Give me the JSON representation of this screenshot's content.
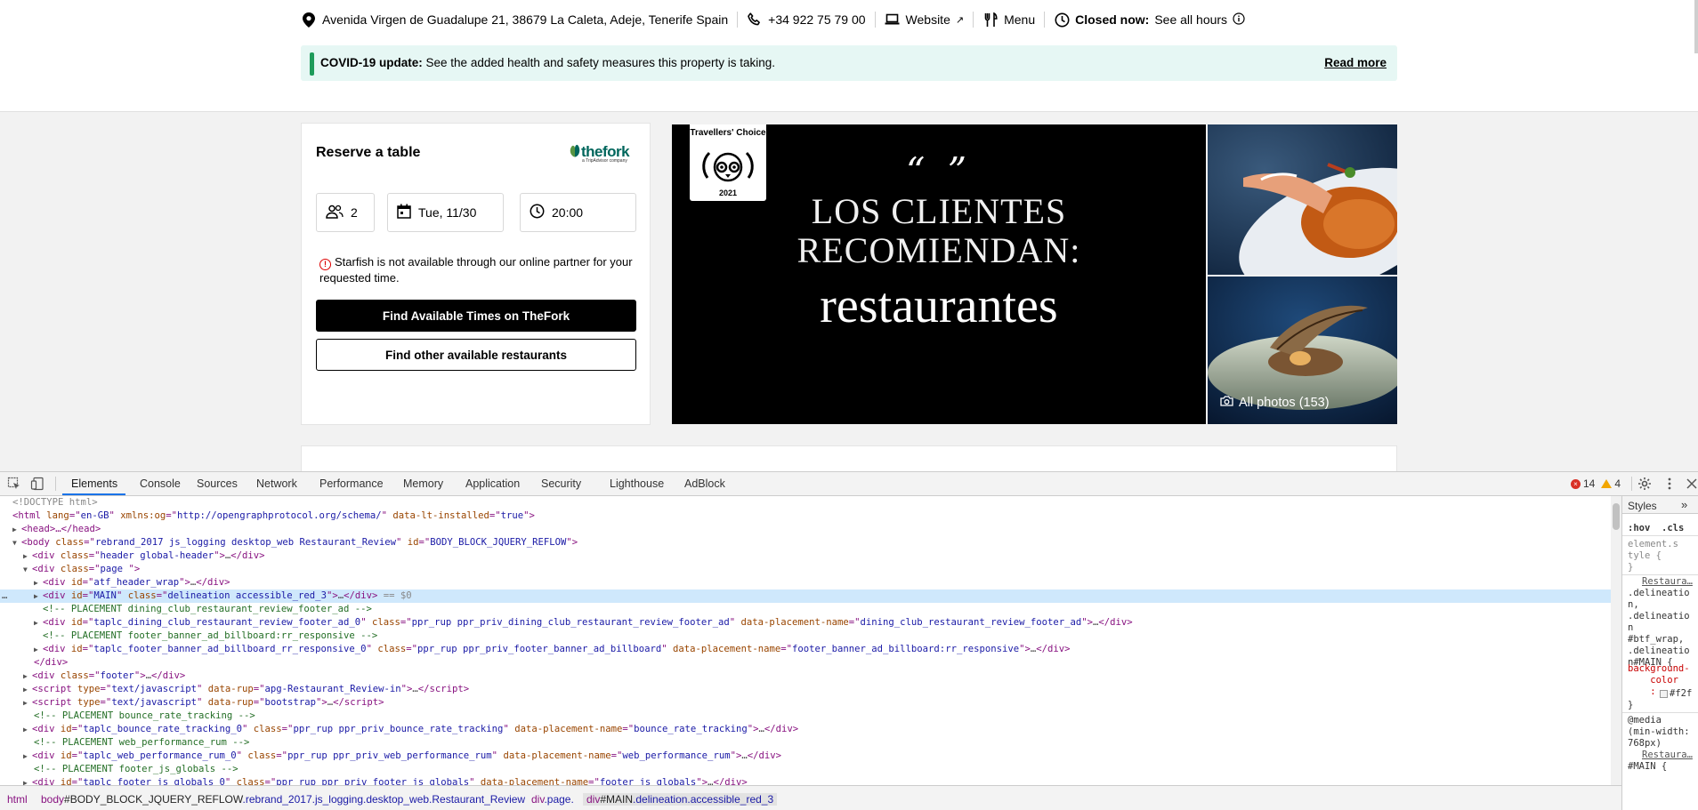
{
  "info": {
    "address": "Avenida Virgen de Guadalupe 21, 38679 La Caleta, Adeje, Tenerife Spain",
    "phone": "+34 922 75 79 00",
    "website": "Website",
    "menu": "Menu",
    "status": "Closed now:",
    "hours": "See all hours"
  },
  "covid": {
    "label": "COVID-19 update:",
    "text": "See the added health and safety measures this property is taking.",
    "read_more": "Read more"
  },
  "reserve": {
    "title": "Reserve a table",
    "partner": "thefork",
    "partner_sub": "a TripAdvisor company",
    "party": "2",
    "date": "Tue, 11/30",
    "time": "20:00",
    "notice": "Starfish is not available through our online partner for your requested time.",
    "find_button": "Find Available Times on TheFork",
    "other_button": "Find other available restaurants"
  },
  "photo": {
    "badge_title": "Travellers' Choice",
    "badge_year": "2021",
    "quote": "“ ”",
    "line1": "LOS CLIENTES",
    "line2": "RECOMIENDAN:",
    "line3": "restaurantes",
    "all_photos": "All photos (153)"
  },
  "devtools": {
    "tabs": [
      "Elements",
      "Console",
      "Sources",
      "Network",
      "Performance",
      "Memory",
      "Application",
      "Security",
      "Lighthouse",
      "AdBlock"
    ],
    "errors": "14",
    "warnings": "4",
    "dom": {
      "doctype": "<!DOCTYPE html>",
      "html_tag": "html",
      "html_attrs": [
        {
          "name": "lang",
          "value": "en-GB"
        },
        {
          "name": "xmlns:og",
          "value": "http://opengraphprotocol.org/schema/"
        },
        {
          "name": "data-lt-installed",
          "value": "true"
        }
      ],
      "head": "<head>…</head>",
      "body_class": "rebrand_2017 js_logging desktop_web Restaurant_Review",
      "body_id": "BODY_BLOCK_JQUERY_REFLOW",
      "header_class": "header global-header",
      "page_class": "page ",
      "atf_id": "atf_header_wrap",
      "main_id": "MAIN",
      "main_class": "delineation accessible_red_3",
      "main_marker": "== $0",
      "comment1": "<!-- PLACEMENT dining_club_restaurant_review_footer_ad -->",
      "div1_id": "taplc_dining_club_restaurant_review_footer_ad_0",
      "div1_class": "ppr_rup ppr_priv_dining_club_restaurant_review_footer_ad",
      "div1_place": "dining_club_restaurant_review_footer_ad",
      "comment2": "<!-- PLACEMENT footer_banner_ad_billboard:rr_responsive -->",
      "div2_id": "taplc_footer_banner_ad_billboard_rr_responsive_0",
      "div2_class": "ppr_rup ppr_priv_footer_banner_ad_billboard",
      "div2_place": "footer_banner_ad_billboard:rr_responsive",
      "footer_class": "footer",
      "script1_rup": "apg-Restaurant_Review-in",
      "script2_rup": "bootstrap",
      "comment3": "<!-- PLACEMENT bounce_rate_tracking -->",
      "div3_id": "taplc_bounce_rate_tracking_0",
      "div3_class": "ppr_rup ppr_priv_bounce_rate_tracking",
      "div3_place": "bounce_rate_tracking",
      "comment4": "<!-- PLACEMENT web_performance_rum -->",
      "div4_id": "taplc_web_performance_rum_0",
      "div4_class": "ppr_rup ppr_priv_web_performance_rum",
      "div4_place": "web_performance_rum",
      "comment5": "<!-- PLACEMENT footer_js_globals -->",
      "div5_id": "taplc_footer_js_globals_0",
      "div5_class": "ppr_rup ppr_priv_footer_js_globals",
      "div5_place": "footer_js_globals",
      "script_type": "text/javascript"
    },
    "styles": {
      "tab": "Styles",
      "hov": ":hov",
      "cls": ".cls",
      "element_style": "element.s\ntyle {\n}",
      "source": "Restaura…",
      "selector": ".delineatio\nn,\n.delineatio\nn\n#btf_wrap,\n.delineatio\nn#MAIN {",
      "prop": "background-\n    color\n    :",
      "value": "#f2f",
      "close": "}",
      "media": "@media\n(min-width:\n768px)",
      "source2": "Restaura…",
      "main2": "#MAIN {"
    },
    "crumbs": {
      "html": "html",
      "body_tag": "body",
      "body_id": "#BODY_BLOCK_JQUERY_REFLOW",
      "body_cls": ".rebrand_2017.js_logging.desktop_web.Restaurant_Review",
      "div_page_tag": "div",
      "div_page_cls": ".page.",
      "div_main_tag": "div",
      "div_main_id": "#MAIN",
      "div_main_cls": ".delineation.accessible_red_3"
    }
  },
  "colors": {
    "covid_bg": "#e6f7f4",
    "covid_bar": "#1e9b5a",
    "page_bg": "#f2f2f2",
    "fork_green": "#00665c",
    "devtools_select": "#cfe8fc",
    "tab_underline": "#1a73e8"
  }
}
